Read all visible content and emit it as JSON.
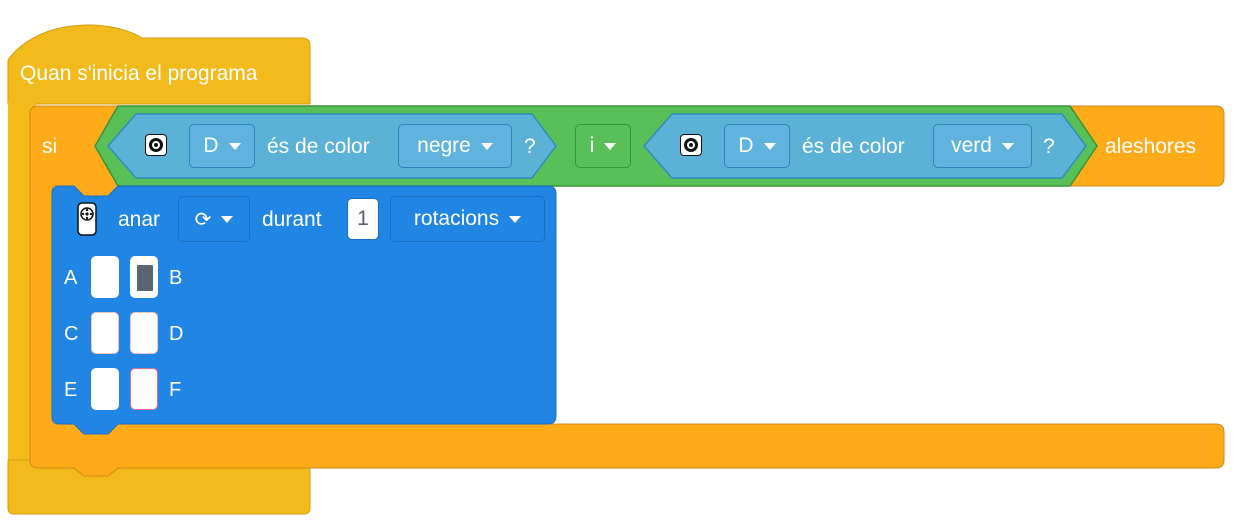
{
  "hat_block": {
    "label": "Quan s'inicia el programa"
  },
  "if_block": {
    "if_label": "si",
    "then_label": "aleshores",
    "operator": {
      "label": "i"
    },
    "condition_left": {
      "icon": "color-sensor-icon",
      "port": "D",
      "label": "és de color",
      "color_value": "negre",
      "question": "?"
    },
    "condition_right": {
      "icon": "color-sensor-icon",
      "port": "D",
      "label": "és de color",
      "color_value": "verd",
      "question": "?"
    }
  },
  "motor_block": {
    "icon": "motor-icon",
    "label_go": "anar",
    "direction_icon": "clockwise-rotation-icon",
    "direction_symbol": "⟳",
    "label_for": "durant",
    "amount": "1",
    "unit": "rotacions",
    "ports": [
      {
        "left": "A",
        "right": "B",
        "right_selected": true
      },
      {
        "left": "C",
        "right": "D",
        "right_selected": false
      },
      {
        "left": "E",
        "right": "F",
        "right_selected": false
      }
    ]
  },
  "colors": {
    "events": "#f2bb1b",
    "control": "#ffab19",
    "operator": "#59c059",
    "sensing": "#5cb1d6",
    "motor": "#2186e3"
  }
}
